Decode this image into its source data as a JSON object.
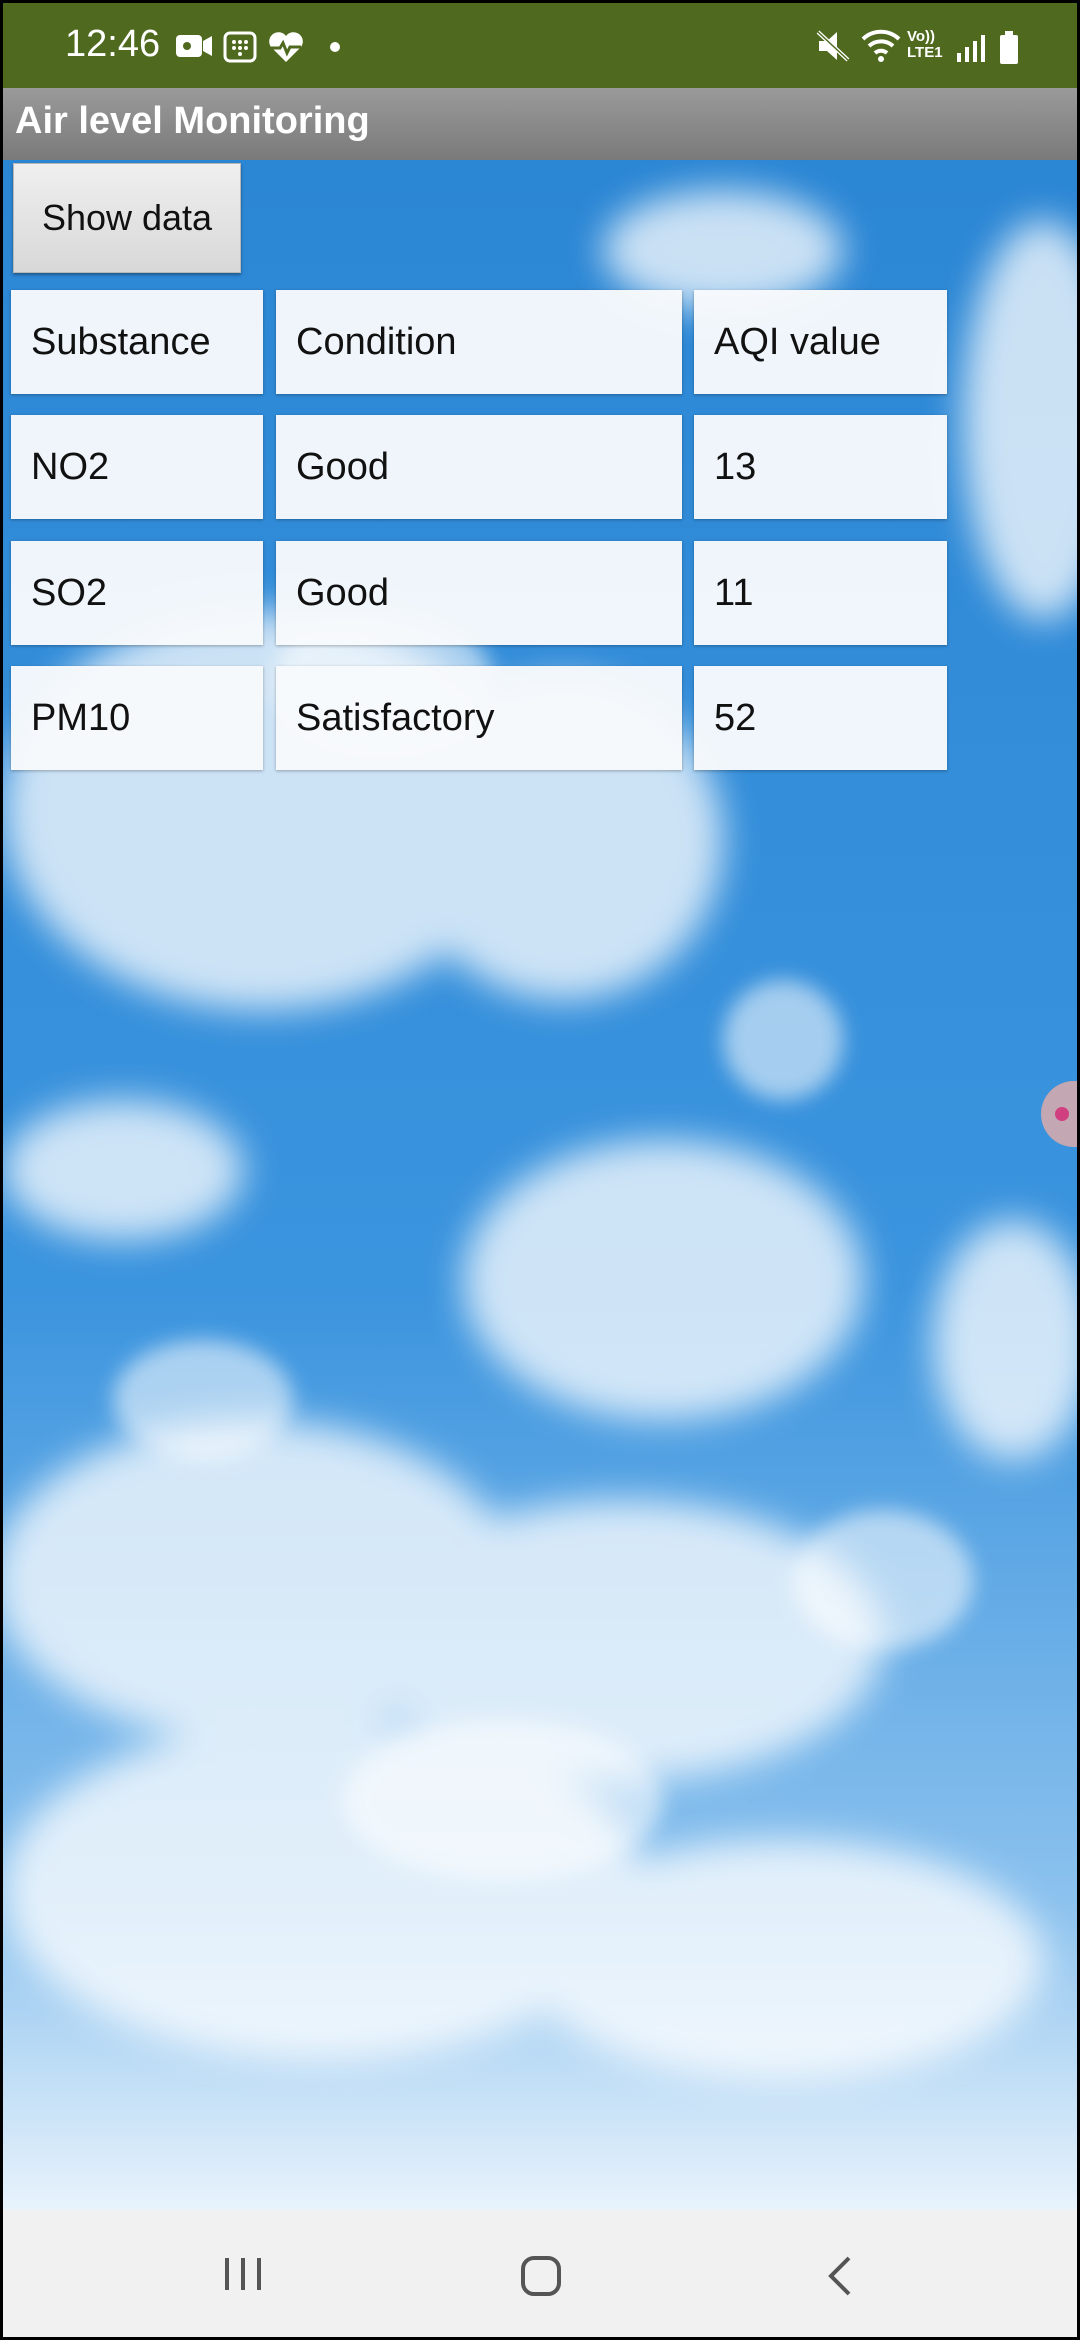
{
  "status_bar": {
    "time": "12:46",
    "left_icons": [
      "video-icon",
      "sim-app-icon",
      "heart-icon",
      "dot-icon"
    ],
    "right_icons": [
      "mute-icon",
      "wifi-icon",
      "volte-icon",
      "signal-icon",
      "battery-icon"
    ],
    "volte_top": "Vo))",
    "volte_bottom": "LTE1"
  },
  "app": {
    "title": "Air level Monitoring"
  },
  "controls": {
    "show_data_label": "Show data"
  },
  "table": {
    "headers": [
      "Substance",
      "Condition",
      "AQI value"
    ],
    "rows": [
      [
        "NO2",
        "Good",
        "13"
      ],
      [
        "SO2",
        "Good",
        "11"
      ],
      [
        "PM10",
        "Satisfactory",
        "52"
      ]
    ]
  },
  "nav_bar": {
    "items": [
      "recent-apps-icon",
      "home-icon",
      "back-icon"
    ]
  },
  "colors": {
    "status_bar": "#4f6a1f",
    "app_bar": "#8a8a8a",
    "sky": "#2f8ad6"
  }
}
